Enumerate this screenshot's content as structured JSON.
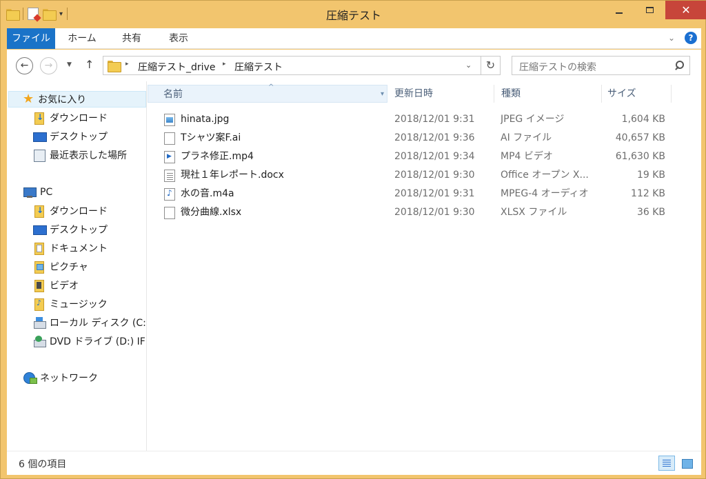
{
  "window": {
    "title": "圧縮テスト",
    "close_glyph": "✕"
  },
  "quick_access": {
    "dropdown_glyph": "▾"
  },
  "ribbon": {
    "tabs": [
      "ファイル",
      "ホーム",
      "共有",
      "表示"
    ],
    "expand_glyph": "⌄",
    "help_glyph": "?"
  },
  "nav": {
    "back_glyph": "←",
    "forward_glyph": "→",
    "recent_glyph": "▼",
    "up_glyph": "↑",
    "breadcrumb": [
      "圧縮テスト_drive",
      "圧縮テスト"
    ],
    "crumb_sep": "▸",
    "address_dropdown_glyph": "⌄",
    "refresh_glyph": "↻",
    "search_placeholder": "圧縮テストの検索"
  },
  "nav_pane": {
    "favorites": {
      "label": "お気に入り",
      "items": [
        "ダウンロード",
        "デスクトップ",
        "最近表示した場所"
      ]
    },
    "pc": {
      "label": "PC",
      "items": [
        "ダウンロード",
        "デスクトップ",
        "ドキュメント",
        "ピクチャ",
        "ビデオ",
        "ミュージック",
        "ローカル ディスク (C:)",
        "DVD ドライブ (D:) IF"
      ]
    },
    "network": {
      "label": "ネットワーク"
    }
  },
  "file_list": {
    "sort_glyph": "^",
    "column_dropdown_glyph": "▾",
    "columns": [
      "名前",
      "更新日時",
      "種類",
      "サイズ"
    ],
    "rows": [
      {
        "name": "hinata.jpg",
        "date": "2018/12/01 9:31",
        "type": "JPEG イメージ",
        "size": "1,604 KB",
        "icon": "image-file-icon"
      },
      {
        "name": "Tシャツ案F.ai",
        "date": "2018/12/01 9:36",
        "type": "AI ファイル",
        "size": "40,657 KB",
        "icon": "generic-file-icon"
      },
      {
        "name": "プラネ修正.mp4",
        "date": "2018/12/01 9:34",
        "type": "MP4 ビデオ",
        "size": "61,630 KB",
        "icon": "video-file-icon"
      },
      {
        "name": "現社１年レポート.docx",
        "date": "2018/12/01 9:30",
        "type": "Office オープン X...",
        "size": "19 KB",
        "icon": "document-file-icon"
      },
      {
        "name": "水の音.m4a",
        "date": "2018/12/01 9:31",
        "type": "MPEG-4 オーディオ",
        "size": "112 KB",
        "icon": "audio-file-icon"
      },
      {
        "name": "微分曲線.xlsx",
        "date": "2018/12/01 9:30",
        "type": "XLSX ファイル",
        "size": "36 KB",
        "icon": "generic-file-icon"
      }
    ]
  },
  "status": {
    "item_count": "6 個の項目"
  },
  "colors": {
    "frame": "#f2c56e",
    "file_tab": "#1a73c8",
    "close_button": "#c7453a",
    "selection": "#e5f3fb"
  }
}
